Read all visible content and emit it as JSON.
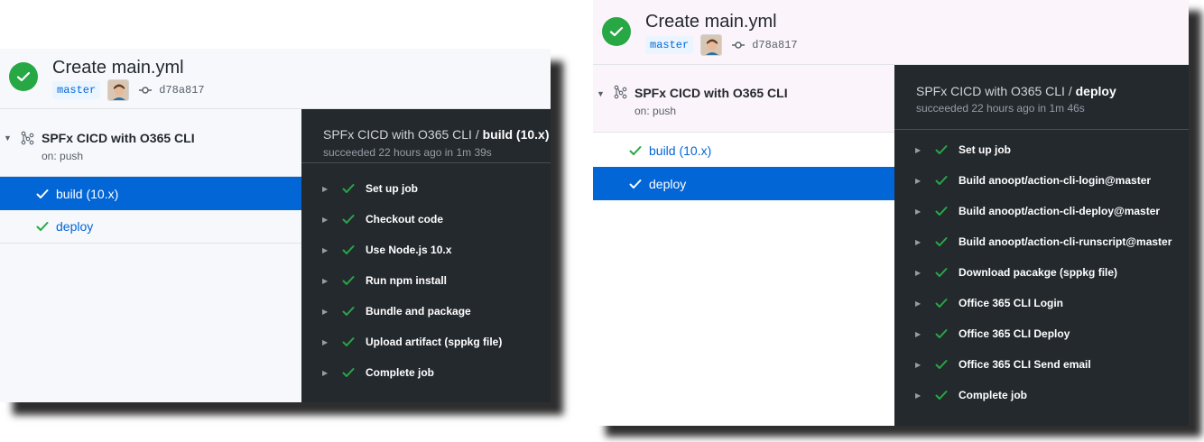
{
  "left_panel": {
    "run_title": "Create main.yml",
    "branch": "master",
    "commit_sha": "d78a817",
    "workflow_name": "SPFx CICD with O365 CLI",
    "workflow_trigger": "on: push",
    "jobs": [
      {
        "label": "build (10.x)",
        "active": true
      },
      {
        "label": "deploy",
        "active": false
      }
    ],
    "log": {
      "title_prefix": "SPFx CICD with O365 CLI / ",
      "title_job": "build (10.x)",
      "subtitle": "succeeded 22 hours ago in 1m 39s",
      "steps": [
        "Set up job",
        "Checkout code",
        "Use Node.js 10.x",
        "Run npm install",
        "Bundle and package",
        "Upload artifact (sppkg file)",
        "Complete job"
      ]
    }
  },
  "right_panel": {
    "run_title": "Create main.yml",
    "branch": "master",
    "commit_sha": "d78a817",
    "workflow_name": "SPFx CICD with O365 CLI",
    "workflow_trigger": "on: push",
    "jobs": [
      {
        "label": "build (10.x)",
        "active": false
      },
      {
        "label": "deploy",
        "active": true
      }
    ],
    "log": {
      "title_prefix": "SPFx CICD with O365 CLI / ",
      "title_job": "deploy",
      "subtitle": "succeeded 22 hours ago in 1m 46s",
      "steps": [
        "Set up job",
        "Build anoopt/action-cli-login@master",
        "Build anoopt/action-cli-deploy@master",
        "Build anoopt/action-cli-runscript@master",
        "Download pacakge (sppkg file)",
        "Office 365 CLI Login",
        "Office 365 CLI Deploy",
        "Office 365 CLI Send email",
        "Complete job"
      ]
    }
  },
  "colors": {
    "success": "#28a745",
    "link": "#0366d6",
    "log_background": "#24292e"
  },
  "icons": {
    "status": "check-circle-icon",
    "commit": "git-commit-icon",
    "workflow": "workflow-icon",
    "step_status": "check-icon",
    "expand": "caret-right-icon",
    "collapse": "caret-down-icon"
  }
}
